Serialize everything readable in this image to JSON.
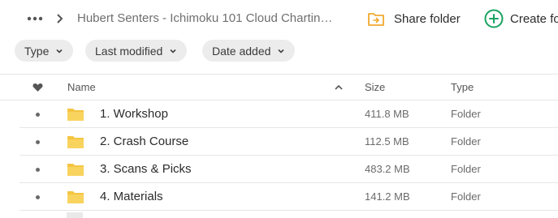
{
  "breadcrumb": {
    "title": "Hubert Senters - Ichimoku 101 Cloud Charting..."
  },
  "actions": {
    "share_label": "Share folder",
    "create_label": "Create fo"
  },
  "filters": [
    {
      "label": "Type"
    },
    {
      "label": "Last modified"
    },
    {
      "label": "Date added"
    }
  ],
  "table": {
    "columns": {
      "name": "Name",
      "size": "Size",
      "type": "Type"
    },
    "rows": [
      {
        "name": "1. Workshop",
        "size": "411.8 MB",
        "type": "Folder"
      },
      {
        "name": "2. Crash Course",
        "size": "112.5 MB",
        "type": "Folder"
      },
      {
        "name": "3. Scans & Picks",
        "size": "483.2 MB",
        "type": "Folder"
      },
      {
        "name": "4. Materials",
        "size": "141.2 MB",
        "type": "Folder"
      }
    ]
  },
  "colors": {
    "folder": "#f5c542",
    "accent_green": "#1aa260",
    "share_icon": "#f0a92e"
  },
  "icons": [
    "more-icon",
    "chevron-right-icon",
    "share-folder-icon",
    "plus-circle-icon",
    "chevron-down-icon",
    "heart-icon",
    "sort-up-icon",
    "folder-icon"
  ]
}
